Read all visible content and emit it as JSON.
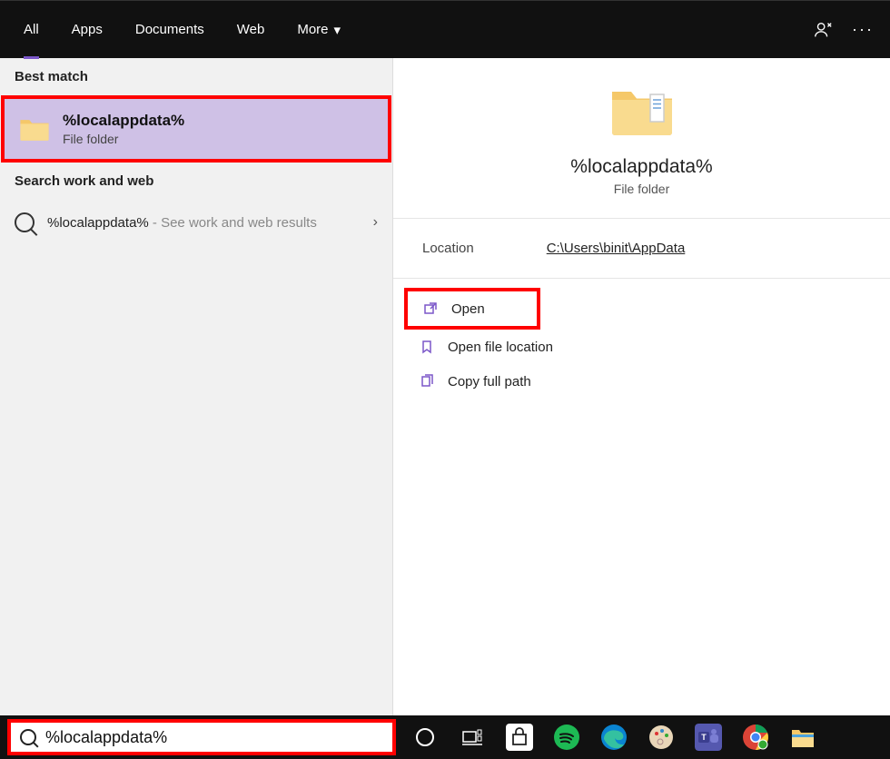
{
  "filter": {
    "all": "All",
    "apps": "Apps",
    "documents": "Documents",
    "web": "Web",
    "more": "More"
  },
  "left": {
    "best_match_label": "Best match",
    "best_match_title": "%localappdata%",
    "best_match_sub": "File folder",
    "sww_label": "Search work and web",
    "sww_query": "%localappdata%",
    "sww_hint": "- See work and web results"
  },
  "right": {
    "title": "%localappdata%",
    "sub": "File folder",
    "location_key": "Location",
    "location_val": "C:\\Users\\binit\\AppData",
    "open": "Open",
    "open_file_location": "Open file location",
    "copy_full_path": "Copy full path"
  },
  "taskbar": {
    "search_value": "%localappdata%"
  }
}
